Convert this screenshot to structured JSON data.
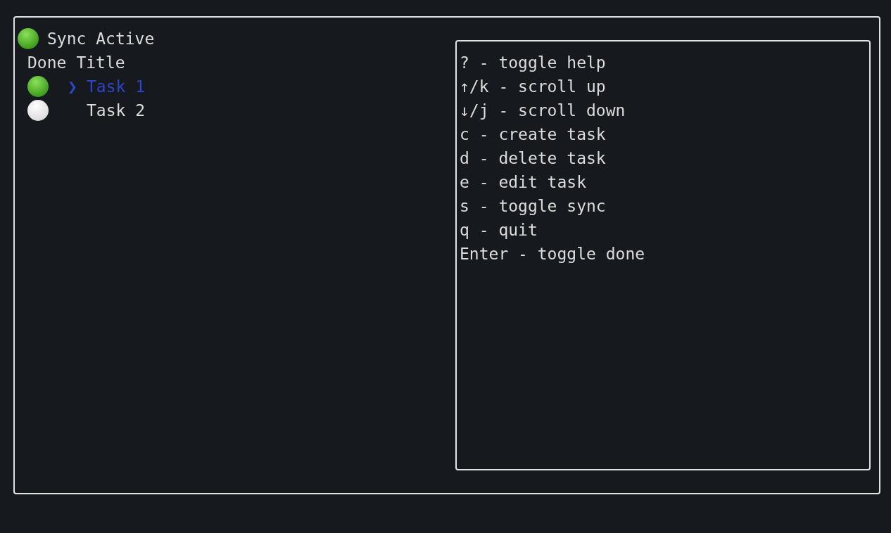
{
  "sync": {
    "active": true,
    "label": "Sync Active"
  },
  "columns": [
    "Done",
    "Title"
  ],
  "cursor": "❯",
  "tasks": [
    {
      "title": "Task 1",
      "done": true,
      "selected": true
    },
    {
      "title": "Task 2",
      "done": false,
      "selected": false
    }
  ],
  "help": [
    "? - toggle help",
    "↑/k - scroll up",
    "↓/j - scroll down",
    "c - create task",
    "d - delete task",
    "e - edit task",
    "s - toggle sync",
    "q - quit",
    "Enter - toggle done"
  ]
}
